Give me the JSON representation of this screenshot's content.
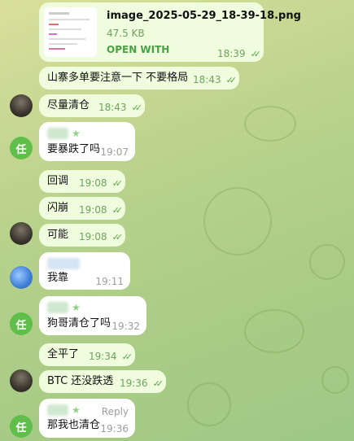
{
  "file": {
    "name": "image_2025-05-29_18-39-18.png",
    "size": "47.5 KB",
    "action": "OPEN WITH",
    "time": "18:39"
  },
  "messages": [
    {
      "text": "山寨多单要注意一下 不要格局",
      "time": "18:43"
    },
    {
      "text": "尽量清仓",
      "time": "18:43"
    },
    {
      "text": "要暴跌了吗",
      "time": "19:07"
    },
    {
      "text": "回调",
      "time": "19:08"
    },
    {
      "text": "闪崩",
      "time": "19:08"
    },
    {
      "text": "可能",
      "time": "19:08"
    },
    {
      "text": "我靠",
      "time": "19:11"
    },
    {
      "text": "狗哥清仓了吗",
      "time": "19:32"
    },
    {
      "text": "全平了",
      "time": "19:34"
    },
    {
      "text": "BTC 还没跌透",
      "time": "19:36"
    },
    {
      "text": "那我也清仓",
      "time": "19:36",
      "reply": "Reply"
    }
  ],
  "avatars": {
    "green_initial": "任"
  },
  "icons": {
    "read_ticks": "double-check-icon",
    "admin_star": "star-icon"
  },
  "colors": {
    "outgoing_bubble": "#effdde",
    "incoming_bubble": "#ffffff",
    "accent": "#58a64b"
  }
}
